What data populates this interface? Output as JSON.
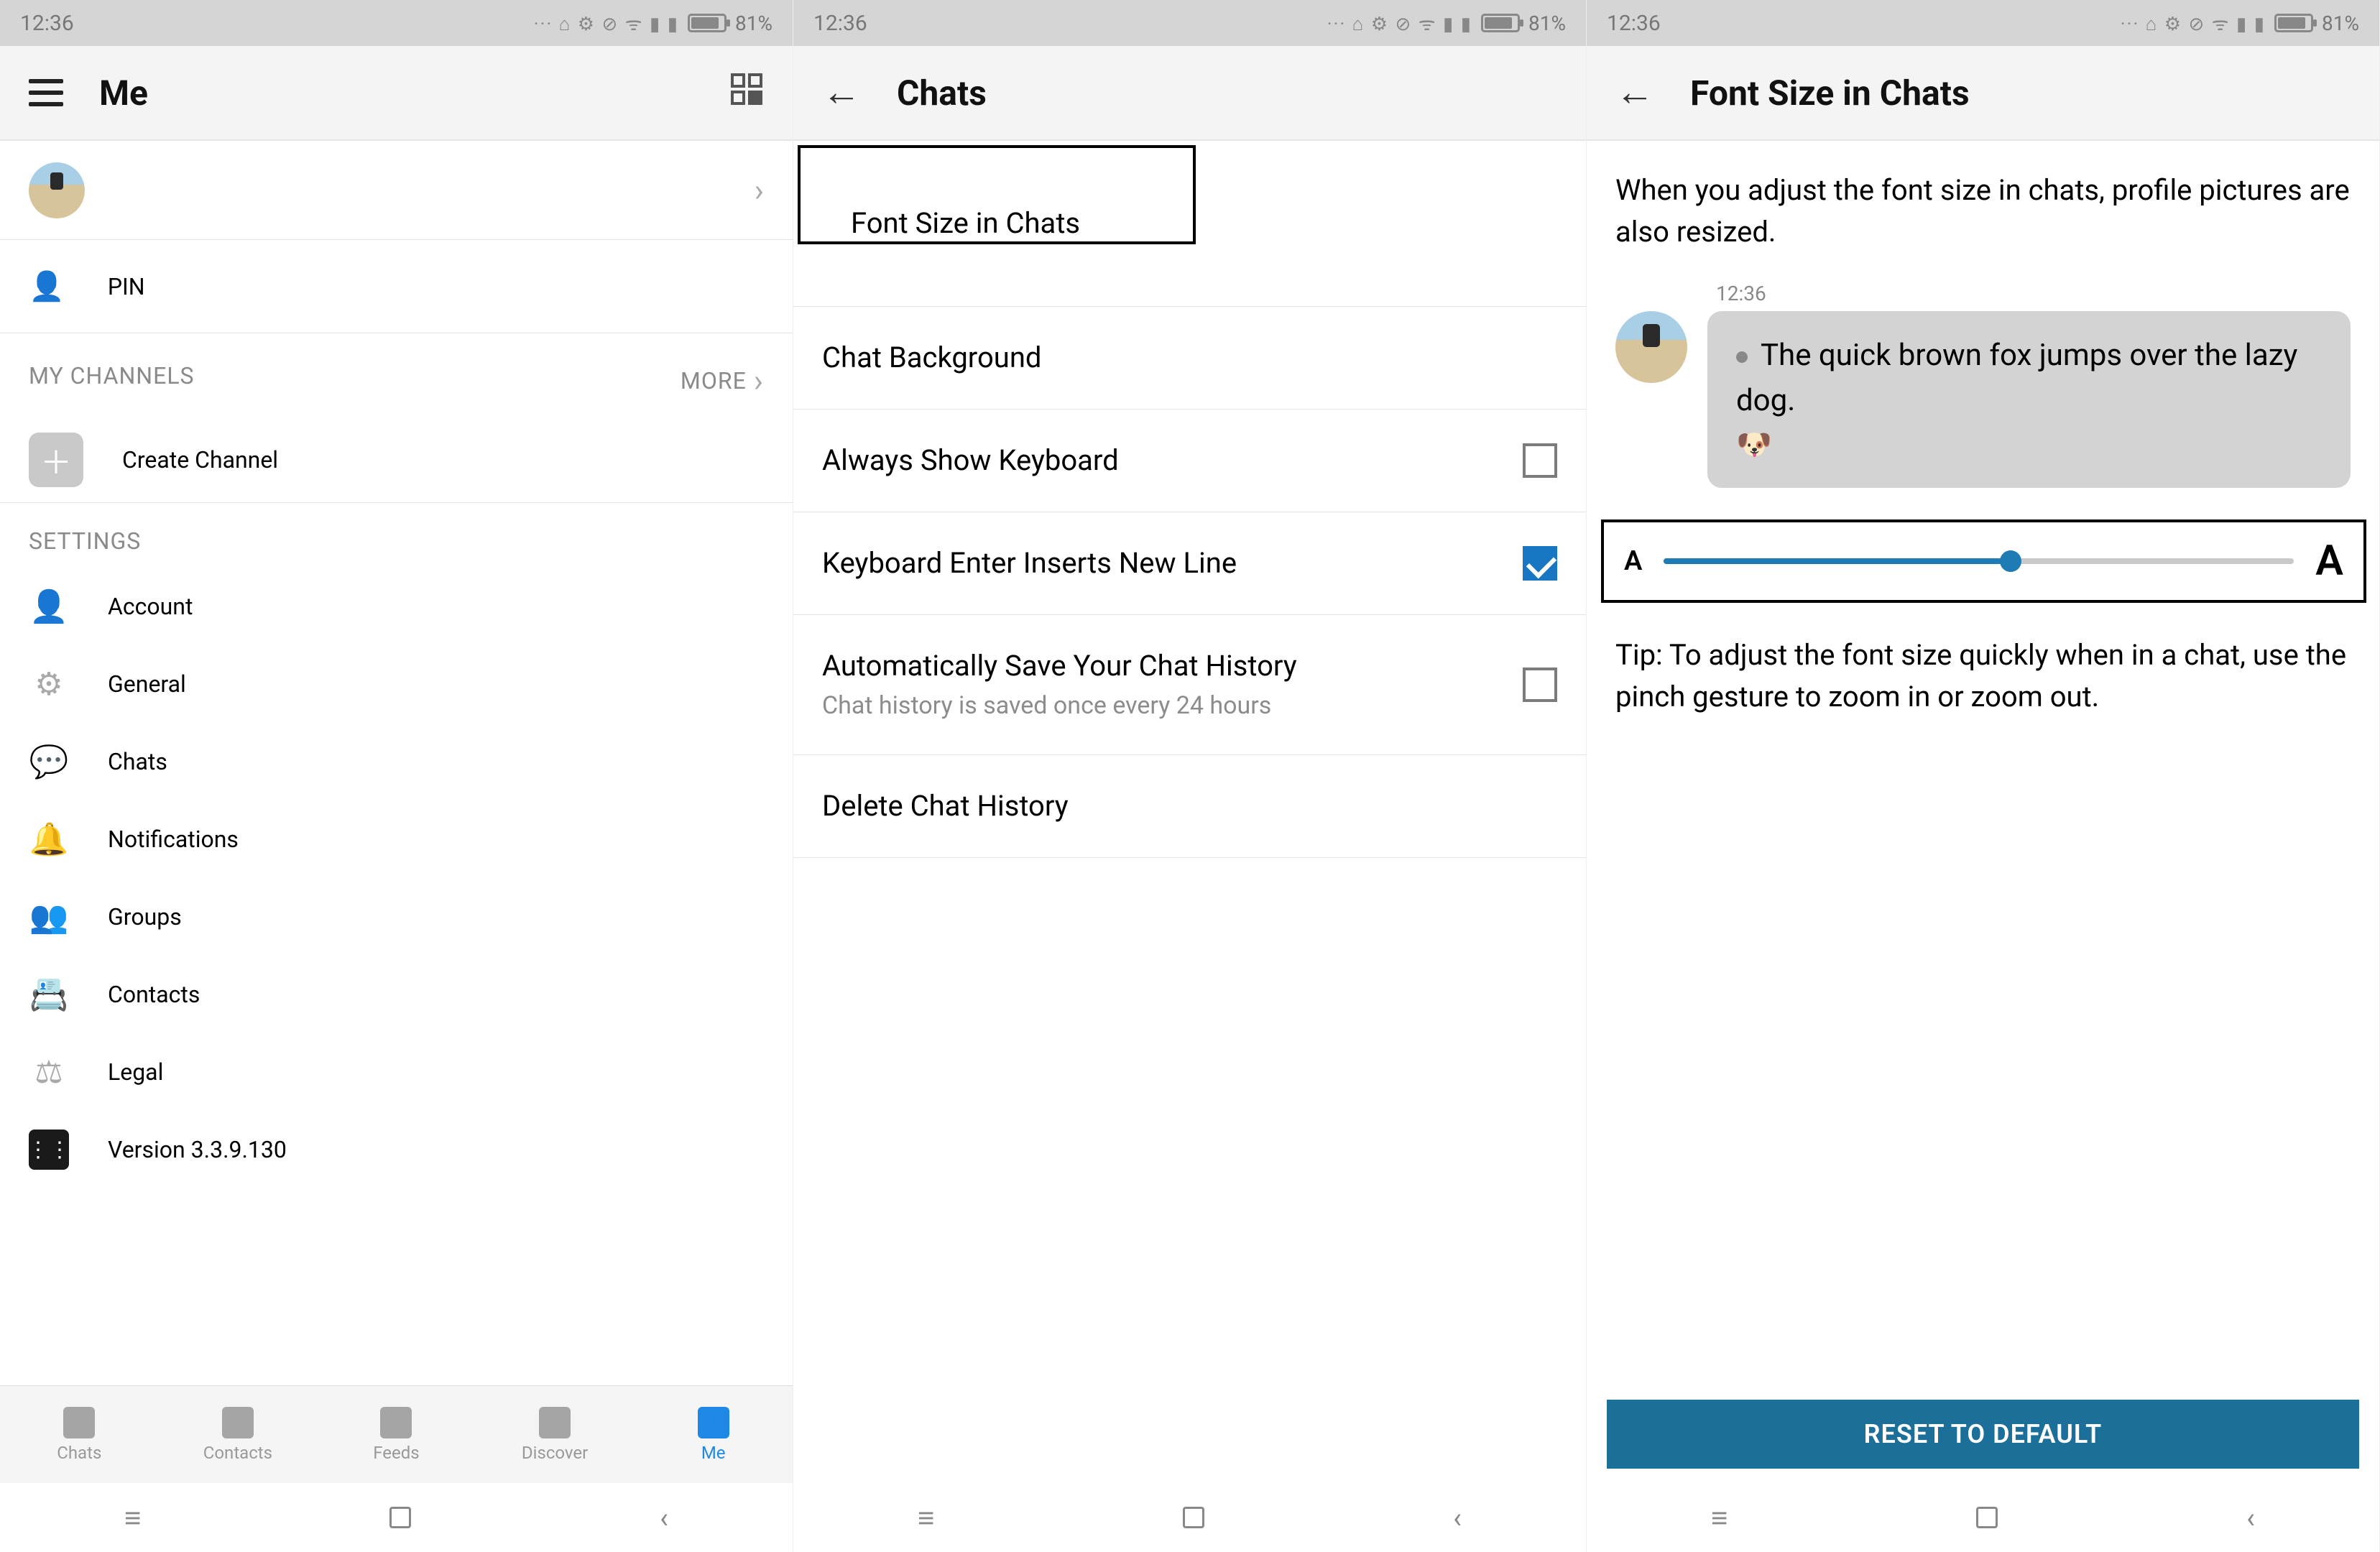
{
  "status": {
    "time": "12:36",
    "battery": "81%"
  },
  "screen1": {
    "title": "Me",
    "pin_label": "PIN",
    "channels_header": "MY CHANNELS",
    "channels_more": "MORE",
    "create_channel": "Create Channel",
    "settings_header": "SETTINGS",
    "settings": [
      "Account",
      "General",
      "Chats",
      "Notifications",
      "Groups",
      "Contacts",
      "Legal",
      "Version 3.3.9.130"
    ],
    "bottom_nav": [
      "Chats",
      "Contacts",
      "Feeds",
      "Discover",
      "Me"
    ],
    "active_tab_index": 4
  },
  "screen2": {
    "title": "Chats",
    "rows": [
      {
        "label": "Font Size in Chats",
        "highlight": true
      },
      {
        "label": "Chat Background"
      },
      {
        "label": "Always Show Keyboard",
        "checkbox": true,
        "checked": false
      },
      {
        "label": "Keyboard Enter Inserts New Line",
        "checkbox": true,
        "checked": true
      },
      {
        "label": "Automatically Save Your Chat History",
        "sub": "Chat history is saved once every 24 hours",
        "checkbox": true,
        "checked": false
      },
      {
        "label": "Delete Chat History"
      }
    ]
  },
  "screen3": {
    "title": "Font Size in Chats",
    "info": "When you adjust the font size in chats, profile pictures are also resized.",
    "timestamp": "12:36",
    "sample": "The quick brown fox jumps over the lazy dog.",
    "emoji": "🐶",
    "slider_small": "A",
    "slider_big": "A",
    "slider_percent": 55,
    "tip": "Tip: To adjust the font size quickly when in a chat, use the pinch gesture to zoom in or zoom out.",
    "reset_label": "RESET TO DEFAULT"
  }
}
